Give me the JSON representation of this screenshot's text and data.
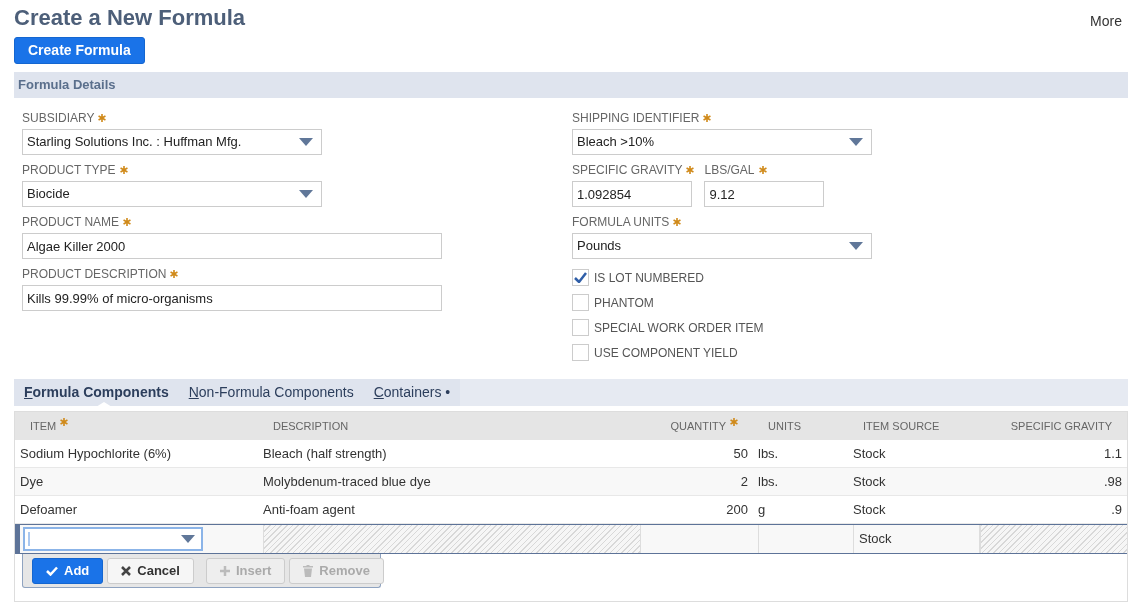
{
  "page": {
    "title": "Create a New Formula",
    "more": "More"
  },
  "primary_button": "Create Formula",
  "section": {
    "title": "Formula Details"
  },
  "left_fields": [
    {
      "kind": "select",
      "label": "SUBSIDIARY",
      "required": true,
      "value": "Starling Solutions Inc. : Huffman Mfg."
    },
    {
      "kind": "select",
      "label": "PRODUCT TYPE",
      "required": true,
      "value": "Biocide"
    },
    {
      "kind": "text",
      "label": "PRODUCT NAME",
      "required": true,
      "value": "Algae Killer 2000"
    },
    {
      "kind": "text",
      "label": "PRODUCT DESCRIPTION",
      "required": true,
      "value": "Kills 99.99% of micro-organisms"
    }
  ],
  "right_fields": [
    {
      "kind": "select",
      "label": "SHIPPING IDENTIFIER",
      "required": true,
      "value": "Bleach >10%"
    },
    {
      "kind": "pair",
      "fields": [
        {
          "label": "SPECIFIC GRAVITY",
          "required": true,
          "value": "1.092854"
        },
        {
          "label": "LBS/GAL",
          "required": true,
          "value": "9.12"
        }
      ]
    },
    {
      "kind": "select",
      "label": "FORMULA UNITS",
      "required": true,
      "value": "Pounds"
    },
    {
      "kind": "checkbox",
      "label": "IS LOT NUMBERED",
      "checked": true
    },
    {
      "kind": "checkbox",
      "label": "PHANTOM",
      "checked": false
    },
    {
      "kind": "checkbox",
      "label": "SPECIAL WORK ORDER ITEM",
      "checked": false
    },
    {
      "kind": "checkbox",
      "label": "USE COMPONENT YIELD",
      "checked": false
    }
  ],
  "tabs": [
    {
      "label": "Formula Components",
      "selected": true
    },
    {
      "label": "Non-Formula Components",
      "selected": false
    },
    {
      "label": "Containers •",
      "selected": false
    }
  ],
  "table": {
    "columns": [
      {
        "label": "ITEM",
        "required": true,
        "numeric": false
      },
      {
        "label": "DESCRIPTION",
        "required": false,
        "numeric": false
      },
      {
        "label": "QUANTITY",
        "required": true,
        "numeric": true
      },
      {
        "label": "UNITS",
        "required": false,
        "numeric": false
      },
      {
        "label": "ITEM SOURCE",
        "required": false,
        "numeric": false
      },
      {
        "label": "SPECIFIC GRAVITY",
        "required": false,
        "numeric": true
      }
    ],
    "rows": [
      [
        "Sodium Hypochlorite (6%)",
        "Bleach (half strength)",
        "50",
        "lbs.",
        "Stock",
        "1.1"
      ],
      [
        "Dye",
        "Molybdenum-traced blue dye",
        "2",
        "lbs.",
        "Stock",
        ".98"
      ],
      [
        "Defoamer",
        "Anti-foam agent",
        "200",
        "g",
        "Stock",
        ".9"
      ]
    ],
    "edit_row": [
      {
        "kind": "select"
      },
      {
        "kind": "locked"
      },
      {
        "kind": "empty"
      },
      {
        "kind": "empty"
      },
      {
        "kind": "text",
        "value": "Stock"
      },
      {
        "kind": "locked"
      }
    ]
  },
  "edit_buttons": [
    {
      "kind": "add",
      "label": "Add",
      "disabled": false
    },
    {
      "kind": "cancel",
      "label": "Cancel",
      "disabled": false
    },
    {
      "kind": "insert",
      "label": "Insert",
      "disabled": true
    },
    {
      "kind": "remove",
      "label": "Remove",
      "disabled": true
    }
  ]
}
